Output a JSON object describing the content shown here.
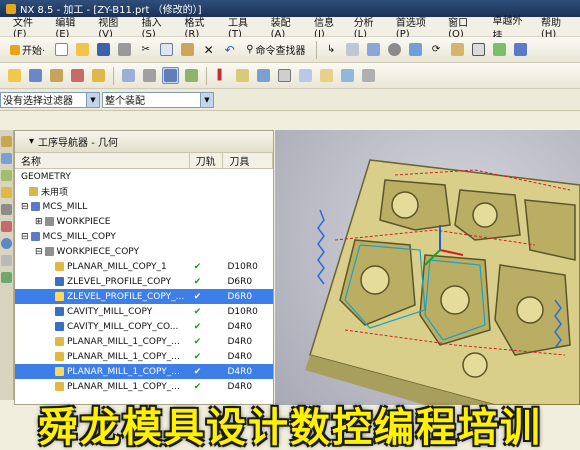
{
  "window": {
    "title": "NX 8.5 - 加工 - [ZY-B11.prt （修改的）]"
  },
  "menu": {
    "items": [
      "文件(F)",
      "编辑(E)",
      "视图(V)",
      "插入(S)",
      "格式(R)",
      "工具(T)",
      "装配(A)",
      "信息(I)",
      "分析(L)",
      "首选项(P)",
      "窗口(O)",
      "卓越外挂",
      "帮助(H)"
    ]
  },
  "toolbar": {
    "start_label": "开始·",
    "command_finder_label": "命令查找器"
  },
  "filters": {
    "selection_filter": "没有选择过滤器",
    "assembly_scope": "整个装配"
  },
  "navigator": {
    "title": "工序导航器 - 几何",
    "columns": {
      "name": "名称",
      "toolpath": "刀轨",
      "tool": "刀具"
    },
    "rows": [
      {
        "name": "GEOMETRY",
        "check": "",
        "tool": ""
      },
      {
        "name": "未用项",
        "check": "",
        "tool": ""
      },
      {
        "name": "MCS_MILL",
        "check": "",
        "tool": ""
      },
      {
        "name": "WORKPIECE",
        "check": "",
        "tool": ""
      },
      {
        "name": "MCS_MILL_COPY",
        "check": "",
        "tool": ""
      },
      {
        "name": "WORKPIECE_COPY",
        "check": "",
        "tool": ""
      },
      {
        "name": "PLANAR_MILL_COPY_1",
        "check": "✔",
        "tool": "D10R0"
      },
      {
        "name": "ZLEVEL_PROFILE_COPY",
        "check": "✔",
        "tool": "D6R0"
      },
      {
        "name": "ZLEVEL_PROFILE_COPY_...",
        "check": "✔",
        "tool": "D6R0"
      },
      {
        "name": "CAVITY_MILL_COPY",
        "check": "✔",
        "tool": "D10R0"
      },
      {
        "name": "CAVITY_MILL_COPY_CO...",
        "check": "✔",
        "tool": "D4R0"
      },
      {
        "name": "PLANAR_MILL_1_COPY_...",
        "check": "✔",
        "tool": "D4R0"
      },
      {
        "name": "PLANAR_MILL_1_COPY_...",
        "check": "✔",
        "tool": "D4R0"
      },
      {
        "name": "PLANAR_MILL_1_COPY_...",
        "check": "✔",
        "tool": "D4R0"
      },
      {
        "name": "PLANAR_MILL_1_COPY_...",
        "check": "✔",
        "tool": "D4R0"
      }
    ]
  },
  "banner": {
    "text": "舜龙模具设计数控编程培训"
  },
  "colors": {
    "accent": "#3d7ee8",
    "banner_text": "#fff200",
    "part_body": "#d9cf8a",
    "check_green": "#1a9a1a"
  }
}
